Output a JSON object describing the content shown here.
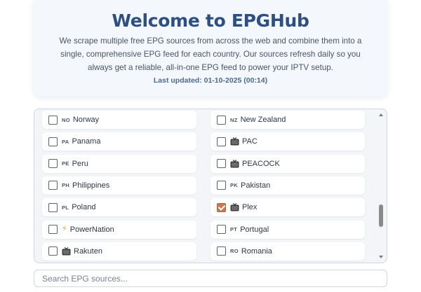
{
  "header": {
    "title": "Welcome to EPGHub",
    "description": "We scrape multiple free EPG sources from across the web and combine them into a single, comprehensive EPG feed for each country. Our sources refresh daily so you always get a reliable, all-in-one EPG feed to power your IPTV setup.",
    "last_updated": "Last updated: 01-10-2025 (00:14)"
  },
  "sources": {
    "left": [
      {
        "code": "NO",
        "label": "Norway",
        "icon": "",
        "checked": false
      },
      {
        "code": "PA",
        "label": "Panama",
        "icon": "",
        "checked": false
      },
      {
        "code": "PE",
        "label": "Peru",
        "icon": "",
        "checked": false
      },
      {
        "code": "PH",
        "label": "Philippines",
        "icon": "",
        "checked": false
      },
      {
        "code": "PL",
        "label": "Poland",
        "icon": "",
        "checked": false
      },
      {
        "code": "",
        "label": "PowerNation",
        "icon": "lightning-icon",
        "checked": false
      },
      {
        "code": "",
        "label": "Rakuten",
        "icon": "tv-icon",
        "checked": false
      }
    ],
    "right": [
      {
        "code": "NZ",
        "label": "New Zealand",
        "icon": "",
        "checked": false
      },
      {
        "code": "",
        "label": "PAC",
        "icon": "tv-icon",
        "checked": false
      },
      {
        "code": "",
        "label": "PEACOCK",
        "icon": "tv-icon",
        "checked": false
      },
      {
        "code": "PK",
        "label": "Pakistan",
        "icon": "",
        "checked": false
      },
      {
        "code": "",
        "label": "Plex",
        "icon": "tv-icon",
        "checked": true
      },
      {
        "code": "PT",
        "label": "Portugal",
        "icon": "",
        "checked": false
      },
      {
        "code": "RO",
        "label": "Romania",
        "icon": "",
        "checked": false
      }
    ]
  },
  "search": {
    "placeholder": "Search EPG sources...",
    "value": ""
  },
  "colors": {
    "title": "#2c4f86",
    "checked": "#c8794f"
  }
}
